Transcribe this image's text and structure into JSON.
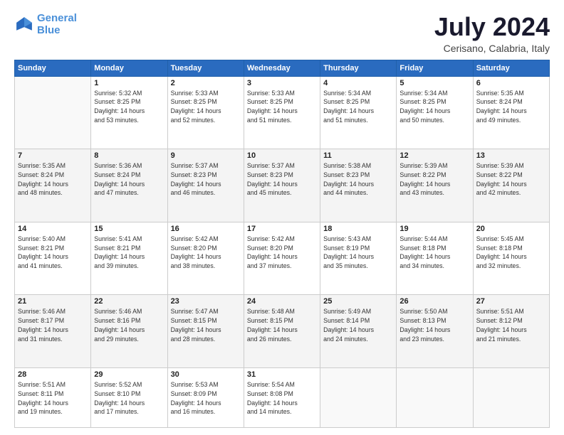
{
  "header": {
    "logo_line1": "General",
    "logo_line2": "Blue",
    "title": "July 2024",
    "subtitle": "Cerisano, Calabria, Italy"
  },
  "weekdays": [
    "Sunday",
    "Monday",
    "Tuesday",
    "Wednesday",
    "Thursday",
    "Friday",
    "Saturday"
  ],
  "weeks": [
    [
      {
        "date": "",
        "info": ""
      },
      {
        "date": "1",
        "info": "Sunrise: 5:32 AM\nSunset: 8:25 PM\nDaylight: 14 hours\nand 53 minutes."
      },
      {
        "date": "2",
        "info": "Sunrise: 5:33 AM\nSunset: 8:25 PM\nDaylight: 14 hours\nand 52 minutes."
      },
      {
        "date": "3",
        "info": "Sunrise: 5:33 AM\nSunset: 8:25 PM\nDaylight: 14 hours\nand 51 minutes."
      },
      {
        "date": "4",
        "info": "Sunrise: 5:34 AM\nSunset: 8:25 PM\nDaylight: 14 hours\nand 51 minutes."
      },
      {
        "date": "5",
        "info": "Sunrise: 5:34 AM\nSunset: 8:25 PM\nDaylight: 14 hours\nand 50 minutes."
      },
      {
        "date": "6",
        "info": "Sunrise: 5:35 AM\nSunset: 8:24 PM\nDaylight: 14 hours\nand 49 minutes."
      }
    ],
    [
      {
        "date": "7",
        "info": "Sunrise: 5:35 AM\nSunset: 8:24 PM\nDaylight: 14 hours\nand 48 minutes."
      },
      {
        "date": "8",
        "info": "Sunrise: 5:36 AM\nSunset: 8:24 PM\nDaylight: 14 hours\nand 47 minutes."
      },
      {
        "date": "9",
        "info": "Sunrise: 5:37 AM\nSunset: 8:23 PM\nDaylight: 14 hours\nand 46 minutes."
      },
      {
        "date": "10",
        "info": "Sunrise: 5:37 AM\nSunset: 8:23 PM\nDaylight: 14 hours\nand 45 minutes."
      },
      {
        "date": "11",
        "info": "Sunrise: 5:38 AM\nSunset: 8:23 PM\nDaylight: 14 hours\nand 44 minutes."
      },
      {
        "date": "12",
        "info": "Sunrise: 5:39 AM\nSunset: 8:22 PM\nDaylight: 14 hours\nand 43 minutes."
      },
      {
        "date": "13",
        "info": "Sunrise: 5:39 AM\nSunset: 8:22 PM\nDaylight: 14 hours\nand 42 minutes."
      }
    ],
    [
      {
        "date": "14",
        "info": "Sunrise: 5:40 AM\nSunset: 8:21 PM\nDaylight: 14 hours\nand 41 minutes."
      },
      {
        "date": "15",
        "info": "Sunrise: 5:41 AM\nSunset: 8:21 PM\nDaylight: 14 hours\nand 39 minutes."
      },
      {
        "date": "16",
        "info": "Sunrise: 5:42 AM\nSunset: 8:20 PM\nDaylight: 14 hours\nand 38 minutes."
      },
      {
        "date": "17",
        "info": "Sunrise: 5:42 AM\nSunset: 8:20 PM\nDaylight: 14 hours\nand 37 minutes."
      },
      {
        "date": "18",
        "info": "Sunrise: 5:43 AM\nSunset: 8:19 PM\nDaylight: 14 hours\nand 35 minutes."
      },
      {
        "date": "19",
        "info": "Sunrise: 5:44 AM\nSunset: 8:18 PM\nDaylight: 14 hours\nand 34 minutes."
      },
      {
        "date": "20",
        "info": "Sunrise: 5:45 AM\nSunset: 8:18 PM\nDaylight: 14 hours\nand 32 minutes."
      }
    ],
    [
      {
        "date": "21",
        "info": "Sunrise: 5:46 AM\nSunset: 8:17 PM\nDaylight: 14 hours\nand 31 minutes."
      },
      {
        "date": "22",
        "info": "Sunrise: 5:46 AM\nSunset: 8:16 PM\nDaylight: 14 hours\nand 29 minutes."
      },
      {
        "date": "23",
        "info": "Sunrise: 5:47 AM\nSunset: 8:15 PM\nDaylight: 14 hours\nand 28 minutes."
      },
      {
        "date": "24",
        "info": "Sunrise: 5:48 AM\nSunset: 8:15 PM\nDaylight: 14 hours\nand 26 minutes."
      },
      {
        "date": "25",
        "info": "Sunrise: 5:49 AM\nSunset: 8:14 PM\nDaylight: 14 hours\nand 24 minutes."
      },
      {
        "date": "26",
        "info": "Sunrise: 5:50 AM\nSunset: 8:13 PM\nDaylight: 14 hours\nand 23 minutes."
      },
      {
        "date": "27",
        "info": "Sunrise: 5:51 AM\nSunset: 8:12 PM\nDaylight: 14 hours\nand 21 minutes."
      }
    ],
    [
      {
        "date": "28",
        "info": "Sunrise: 5:51 AM\nSunset: 8:11 PM\nDaylight: 14 hours\nand 19 minutes."
      },
      {
        "date": "29",
        "info": "Sunrise: 5:52 AM\nSunset: 8:10 PM\nDaylight: 14 hours\nand 17 minutes."
      },
      {
        "date": "30",
        "info": "Sunrise: 5:53 AM\nSunset: 8:09 PM\nDaylight: 14 hours\nand 16 minutes."
      },
      {
        "date": "31",
        "info": "Sunrise: 5:54 AM\nSunset: 8:08 PM\nDaylight: 14 hours\nand 14 minutes."
      },
      {
        "date": "",
        "info": ""
      },
      {
        "date": "",
        "info": ""
      },
      {
        "date": "",
        "info": ""
      }
    ]
  ]
}
